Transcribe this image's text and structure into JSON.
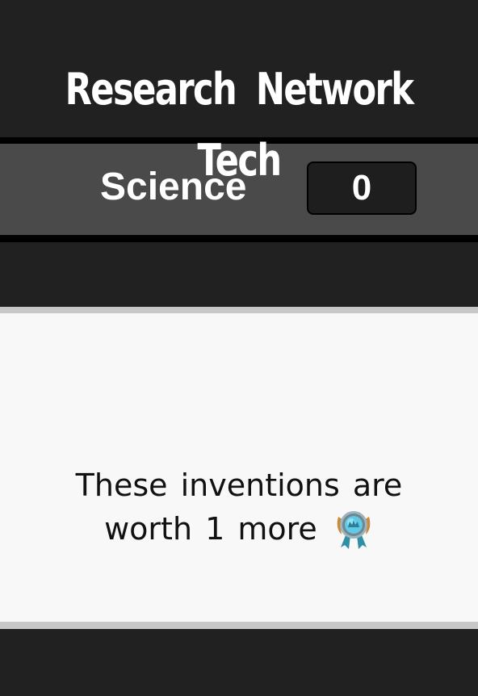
{
  "header": {
    "title_line1": "Research Network",
    "title_line2": "Tech"
  },
  "science": {
    "label": "Science",
    "count": "0"
  },
  "card": {
    "text_line1": "These inventions are",
    "text_line2": "worth 1 more",
    "icon": "medal-icon"
  },
  "colors": {
    "background": "#212121",
    "science_bar": "#4a4a4a",
    "card": "#f8f8f8",
    "divider": "#c8c8c8"
  }
}
